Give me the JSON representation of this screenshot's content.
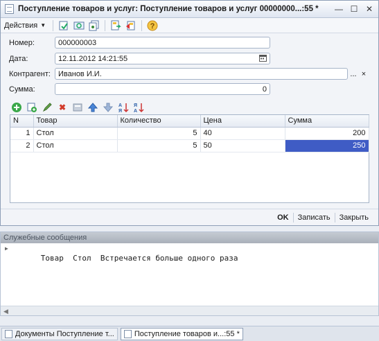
{
  "window": {
    "title": "Поступление товаров и услуг: Поступление товаров и услуг 00000000...:55 *",
    "controls": [
      "minimize",
      "maximize",
      "close"
    ]
  },
  "toolbar": {
    "actions_label": "Действия"
  },
  "form": {
    "number": {
      "label": "Номер:",
      "value": "000000003"
    },
    "date": {
      "label": "Дата:",
      "value": "12.11.2012 14:21:55"
    },
    "counterparty": {
      "label": "Контрагент:",
      "value": "Иванов И.И.",
      "select_label": "...",
      "clear_label": "×"
    },
    "sum": {
      "label": "Сумма:",
      "value": "0"
    }
  },
  "grid": {
    "columns": [
      "N",
      "Товар",
      "Количество",
      "Цена",
      "Сумма"
    ],
    "rows": [
      {
        "n": "1",
        "item": "Стол",
        "qty": "5",
        "price": "40",
        "sum": "200"
      },
      {
        "n": "2",
        "item": "Стол",
        "qty": "5",
        "price": "50",
        "sum": "250"
      }
    ]
  },
  "buttons": {
    "ok": "OK",
    "save": "Записать",
    "close": "Закрыть"
  },
  "messages": {
    "title": "Служебные сообщения",
    "items": [
      "Товар  Стол  Встречается больше одного раза"
    ]
  },
  "taskbar": {
    "tabs": [
      "Документы Поступление т...",
      "Поступление товаров и...:55 *"
    ]
  },
  "colors": {
    "selection": "#3f5cc5",
    "accent": "#8e9fb7"
  }
}
